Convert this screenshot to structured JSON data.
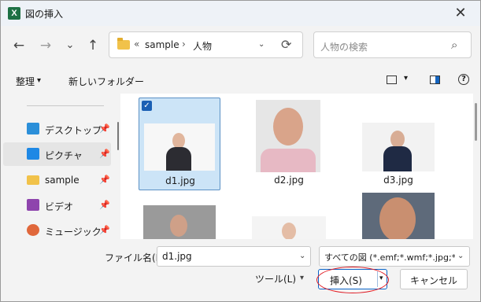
{
  "window": {
    "title": "図の挿入",
    "app_icon_letter": "X"
  },
  "nav": {
    "back": "←",
    "forward": "→",
    "recent": "⌄",
    "up": "↑"
  },
  "address": {
    "prefix": "«",
    "path": [
      "sample",
      "人物"
    ],
    "sep": "›",
    "refresh": "⟳"
  },
  "search": {
    "placeholder": "人物の検索",
    "icon": "⌕"
  },
  "toolbar": {
    "organize": "整理",
    "new_folder": "新しいフォルダー",
    "caret": "▾",
    "help": "?"
  },
  "sidebar": {
    "items": [
      {
        "label": "デスクトップ",
        "icon": "desktop-icon",
        "color": "#2b8fd9",
        "selected": false
      },
      {
        "label": "ピクチャ",
        "icon": "pictures-icon",
        "color": "#1e88e5",
        "selected": true
      },
      {
        "label": "sample",
        "icon": "folder-icon",
        "color": "#f1c24a",
        "selected": false
      },
      {
        "label": "ビデオ",
        "icon": "videos-icon",
        "color": "#8e44ad",
        "selected": false
      },
      {
        "label": "ミュージック",
        "icon": "music-icon",
        "color": "#e0673b",
        "selected": false
      }
    ],
    "pin": "📌"
  },
  "files": [
    {
      "name": "d1.jpg",
      "selected": true
    },
    {
      "name": "d2.jpg",
      "selected": false
    },
    {
      "name": "d3.jpg",
      "selected": false
    },
    {
      "name": "",
      "selected": false
    },
    {
      "name": "",
      "selected": false
    },
    {
      "name": "",
      "selected": false
    }
  ],
  "bottom": {
    "filename_label": "ファイル名(N):",
    "filename_value": "d1.jpg",
    "filetype_value": "すべての図 (*.emf;*.wmf;*.jpg;*.jp",
    "tools_label": "ツール(L)",
    "insert_label": "挿入(S)",
    "cancel_label": "キャンセル",
    "caret": "▾",
    "check": "✓"
  },
  "colors": {
    "accent": "#0a64c8",
    "highlight": "#e01b24",
    "selection": "#cce4f7"
  }
}
